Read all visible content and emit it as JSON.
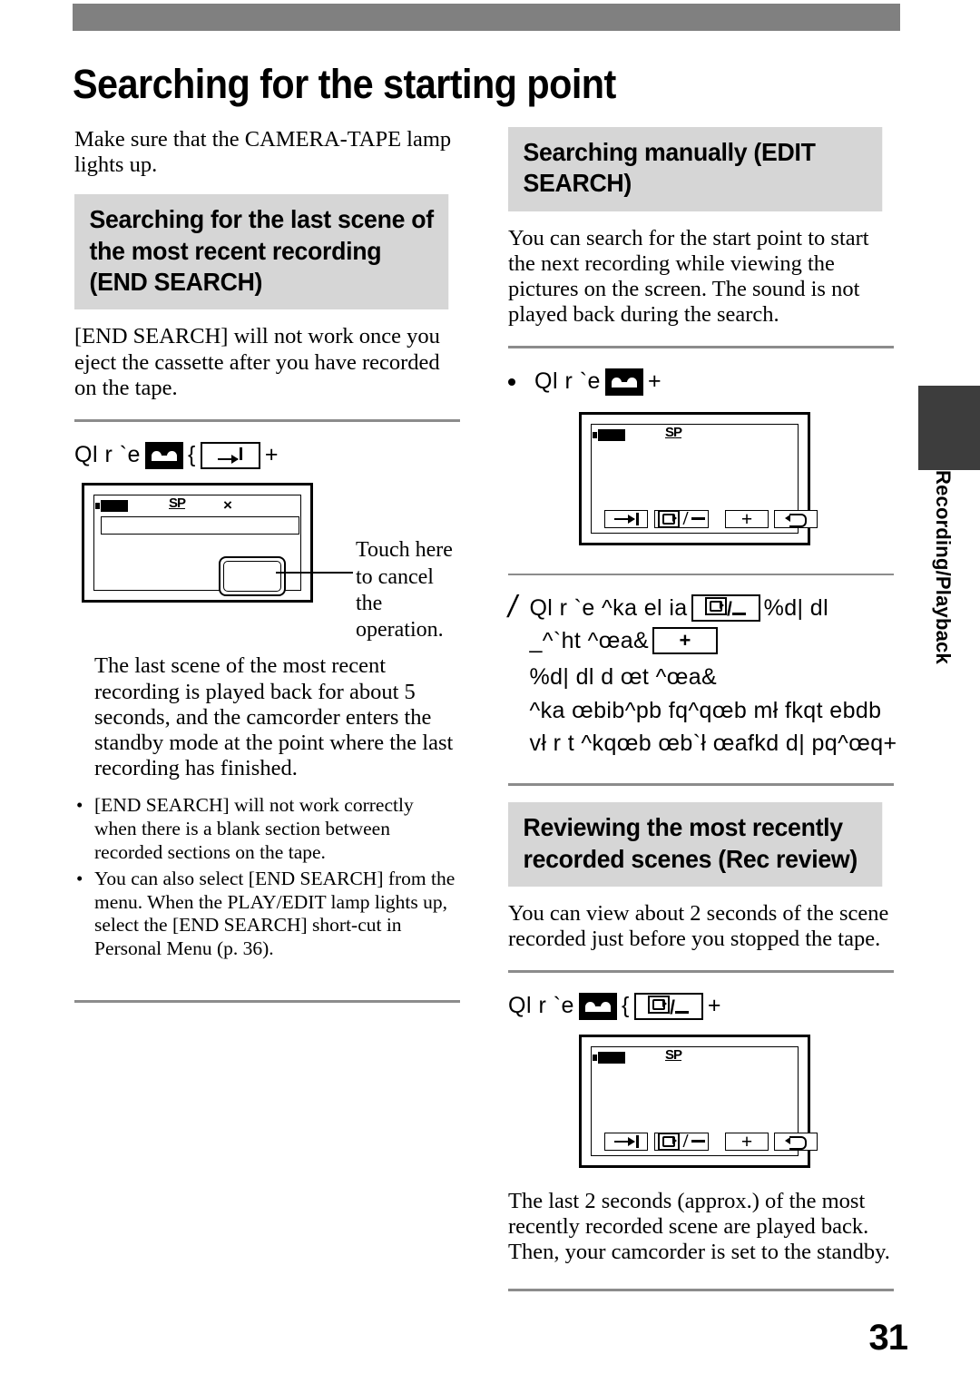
{
  "page": {
    "title": "Searching for the starting point",
    "number": "31",
    "side_tab_label": "Recording/Playback"
  },
  "left_column": {
    "intro": "Make sure that the CAMERA-TAPE lamp lights up.",
    "section_heading": "Searching for the last scene of the most recent recording (END SEARCH)",
    "section_intro": "[END SEARCH] will not work once you eject the cassette after you have recorded on the tape.",
    "instruction": {
      "prefix": "Ql r `e",
      "icon_tape": "tape-mode-icon",
      "separator": "{",
      "icon_button": "end-search-icon",
      "suffix": "+"
    },
    "diagram": {
      "battery": "battery-icon",
      "sp_label": "SP",
      "x_label": "×",
      "cancel_button": "cancel-touch-button"
    },
    "callout": "Touch here to cancel the operation.",
    "result_text": "The last scene of the most recent recording is played back for about 5 seconds, and the camcorder enters the standby mode at the point where the last recording has finished.",
    "notes": [
      "[END SEARCH] will not work correctly when there is a blank section between recorded sections on the tape.",
      "You can also select [END SEARCH] from the menu. When the PLAY/EDIT lamp lights up, select the [END SEARCH] short-cut in Personal Menu (p. 36)."
    ]
  },
  "right_column": {
    "section_heading_1": "Searching manually (EDIT SEARCH)",
    "section_intro_1": "You can search for the start point to start the next recording while viewing the pictures on the screen. The sound is not played back during the search.",
    "step_bullet": {
      "prefix": "Ql r `e",
      "icon_tape": "tape-mode-icon",
      "suffix": "+"
    },
    "diagram_1": {
      "battery": "battery-icon",
      "sp_label": "SP",
      "soft_keys": [
        "end-search-icon",
        "rec-review-icon",
        "+",
        "return-icon"
      ]
    },
    "step_2": {
      "number": "/",
      "line1_a": "Ql r `e ^ka el ia",
      "line1_icon": "rec-review-icon",
      "line1_b": "%d| dl",
      "line2_a": "_^`ht ^œa&",
      "line2_icon": "plus-icon",
      "line2_b": "%d| dl d œt ^œa&",
      "line3": "^ka œbib^pb fq^qœb mł fkqt ebdb",
      "line4": "vł r t ^kqœb œb`ł œafkd d| pq^œq+"
    },
    "section_heading_2": "Reviewing the most recently recorded scenes (Rec review)",
    "section_intro_2": "You can view about 2 seconds of the scene recorded just before you stopped the tape.",
    "instruction_2": {
      "prefix": "Ql r `e",
      "icon_tape": "tape-mode-icon",
      "separator": "{",
      "icon_button": "rec-review-icon",
      "suffix": "+"
    },
    "diagram_2": {
      "battery": "battery-icon",
      "sp_label": "SP",
      "soft_keys": [
        "end-search-icon",
        "rec-review-icon",
        "+",
        "return-icon"
      ]
    },
    "result_text_2": "The last 2 seconds (approx.) of the most recently recorded scene are played back. Then, your camcorder is set to the standby."
  }
}
